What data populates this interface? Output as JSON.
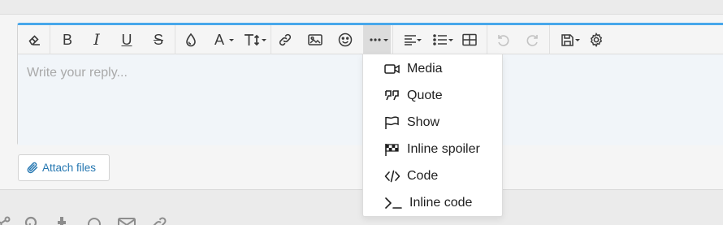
{
  "editor": {
    "placeholder": "Write your reply...",
    "accent_color": "#47a7eb"
  },
  "toolbar": {
    "buttons": [
      {
        "name": "remove-format",
        "icon": "eraser-icon"
      },
      {
        "name": "bold",
        "label": "B",
        "icon": "bold-icon"
      },
      {
        "name": "italic",
        "label": "I",
        "icon": "italic-icon"
      },
      {
        "name": "underline",
        "label": "U",
        "icon": "underline-icon"
      },
      {
        "name": "strikethrough",
        "label": "S",
        "icon": "strikethrough-icon"
      },
      {
        "name": "text-color",
        "icon": "droplet-icon"
      },
      {
        "name": "font-family",
        "label": "A",
        "icon": "font-icon"
      },
      {
        "name": "font-size",
        "label": "T",
        "icon": "text-size-icon"
      },
      {
        "name": "insert-link",
        "icon": "link-icon"
      },
      {
        "name": "insert-image",
        "icon": "image-icon"
      },
      {
        "name": "smilies",
        "icon": "smile-icon"
      },
      {
        "name": "more-options",
        "icon": "ellipsis-icon"
      },
      {
        "name": "align",
        "icon": "align-left-icon"
      },
      {
        "name": "list",
        "icon": "list-icon"
      },
      {
        "name": "insert-table",
        "icon": "table-icon"
      },
      {
        "name": "undo",
        "icon": "undo-icon"
      },
      {
        "name": "redo",
        "icon": "redo-icon"
      },
      {
        "name": "drafts",
        "icon": "save-icon"
      },
      {
        "name": "toggle-bbcode",
        "icon": "gear-icon"
      }
    ]
  },
  "more_menu": {
    "items": [
      {
        "label": "Media",
        "icon": "video-camera-icon"
      },
      {
        "label": "Quote",
        "icon": "quote-icon"
      },
      {
        "label": "Show",
        "icon": "flag-icon"
      },
      {
        "label": "Inline spoiler",
        "icon": "checkered-flag-icon"
      },
      {
        "label": "Code",
        "icon": "code-icon"
      },
      {
        "label": "Inline code",
        "icon": "terminal-icon"
      }
    ]
  },
  "attach": {
    "label": "Attach files",
    "color": "#2577b1",
    "icon": "paperclip-icon"
  },
  "share_row": {
    "icons": [
      "share-icon",
      "pinterest-icon",
      "tumblr-icon",
      "whatsapp-icon",
      "email-icon",
      "link-icon"
    ]
  }
}
